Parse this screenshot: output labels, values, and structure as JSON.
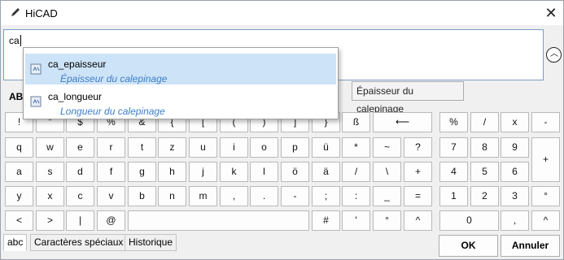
{
  "window": {
    "title": "HiCAD",
    "close_label": "✕"
  },
  "input": {
    "value": "ca",
    "hint": "Épaisseur du calepinage",
    "up_icon": "chevron-up-icon"
  },
  "autocomplete": [
    {
      "name": "ca_epaisseur",
      "description": "Épaisseur du calepinage",
      "selected": true
    },
    {
      "name": "ca_longueur",
      "description": "Longueur du calepinage",
      "selected": false
    }
  ],
  "mode_fragment": "AB",
  "keys": {
    "row1": [
      "!",
      "\"",
      "$",
      "%",
      "&",
      "{",
      "[",
      "(",
      ")",
      "]",
      "}",
      "ß",
      "⟵"
    ],
    "row2": [
      "q",
      "w",
      "e",
      "r",
      "t",
      "z",
      "u",
      "i",
      "o",
      "p",
      "ü",
      "*",
      "~",
      "?"
    ],
    "row3": [
      "a",
      "s",
      "d",
      "f",
      "g",
      "h",
      "j",
      "k",
      "l",
      "ö",
      "ä",
      "/",
      "\\",
      "+"
    ],
    "row4": [
      "y",
      "x",
      "c",
      "v",
      "b",
      "n",
      "m",
      ",",
      ".",
      "-",
      ";",
      ":",
      "_",
      "="
    ],
    "row5": [
      "<",
      ">",
      "|",
      "@",
      "#",
      "'",
      "°",
      "^"
    ],
    "numpad": {
      "row1": [
        "%",
        "/",
        "x",
        "-"
      ],
      "row2": [
        "7",
        "8",
        "9"
      ],
      "row3": [
        "4",
        "5",
        "6"
      ],
      "row4": [
        "1",
        "2",
        "3",
        "°"
      ],
      "row5": [
        "0",
        ",",
        "^"
      ],
      "plus": "+"
    }
  },
  "tabs": [
    "abc",
    "Caractères spéciaux",
    "Historique"
  ],
  "buttons": {
    "ok": "OK",
    "cancel": "Annuler"
  }
}
